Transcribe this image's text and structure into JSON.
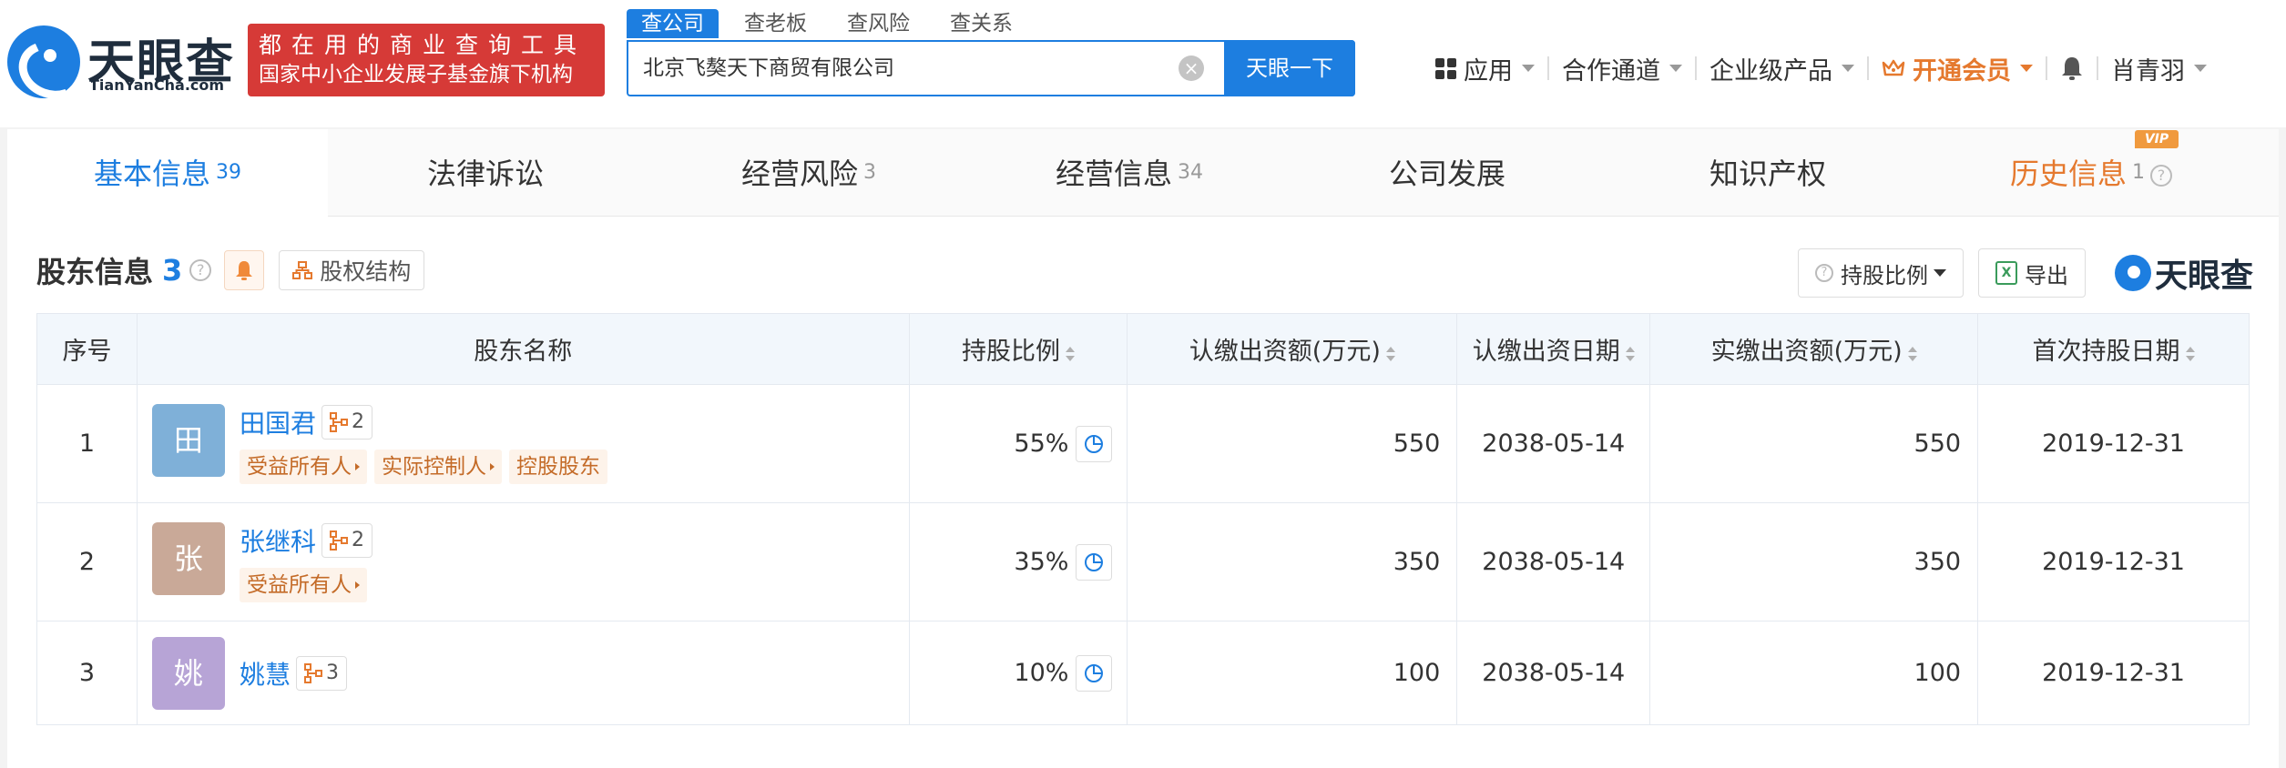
{
  "header": {
    "logo_text": "天眼查",
    "logo_sub": "TianYanCha.com",
    "promo_line1": "都在用的商业查询工具",
    "promo_line2": "国家中小企业发展子基金旗下机构",
    "search_tabs": [
      "查公司",
      "查老板",
      "查风险",
      "查关系"
    ],
    "search_value": "北京飞獒天下商贸有限公司",
    "search_button": "天眼一下",
    "nav": {
      "apps": "应用",
      "partner": "合作通道",
      "enterprise": "企业级产品",
      "vip": "开通会员",
      "user": "肖青羽"
    }
  },
  "tabs": [
    {
      "label": "基本信息",
      "count": "39"
    },
    {
      "label": "法律诉讼",
      "count": ""
    },
    {
      "label": "经营风险",
      "count": "3"
    },
    {
      "label": "经营信息",
      "count": "34"
    },
    {
      "label": "公司发展",
      "count": ""
    },
    {
      "label": "知识产权",
      "count": ""
    },
    {
      "label": "历史信息",
      "count": "1"
    }
  ],
  "vip_badge": "VIP",
  "section": {
    "title": "股东信息",
    "count": "3",
    "structure_button": "股权结构",
    "ratio_button": "持股比例",
    "export_button": "导出",
    "brand": "天眼查"
  },
  "table": {
    "headers": [
      "序号",
      "股东名称",
      "持股比例",
      "认缴出资额(万元)",
      "认缴出资日期",
      "实缴出资额(万元)",
      "首次持股日期"
    ],
    "rows": [
      {
        "idx": "1",
        "avatar": "田",
        "avatar_color": "#7fb0d8",
        "name": "田国君",
        "rel_count": "2",
        "tags": [
          "受益所有人",
          "实际控制人",
          "控股股东"
        ],
        "pct": "55%",
        "sub_amt": "550",
        "sub_date": "2038-05-14",
        "paid_amt": "550",
        "first_date": "2019-12-31"
      },
      {
        "idx": "2",
        "avatar": "张",
        "avatar_color": "#c9a998",
        "name": "张继科",
        "rel_count": "2",
        "tags": [
          "受益所有人"
        ],
        "pct": "35%",
        "sub_amt": "350",
        "sub_date": "2038-05-14",
        "paid_amt": "350",
        "first_date": "2019-12-31"
      },
      {
        "idx": "3",
        "avatar": "姚",
        "avatar_color": "#b7a4d6",
        "name": "姚慧",
        "rel_count": "3",
        "tags": [],
        "pct": "10%",
        "sub_amt": "100",
        "sub_date": "2038-05-14",
        "paid_amt": "100",
        "first_date": "2019-12-31"
      }
    ]
  },
  "colors": {
    "brand_blue": "#1d7ee0",
    "promo_red": "#d63a37",
    "vip_orange": "#e5792e"
  }
}
